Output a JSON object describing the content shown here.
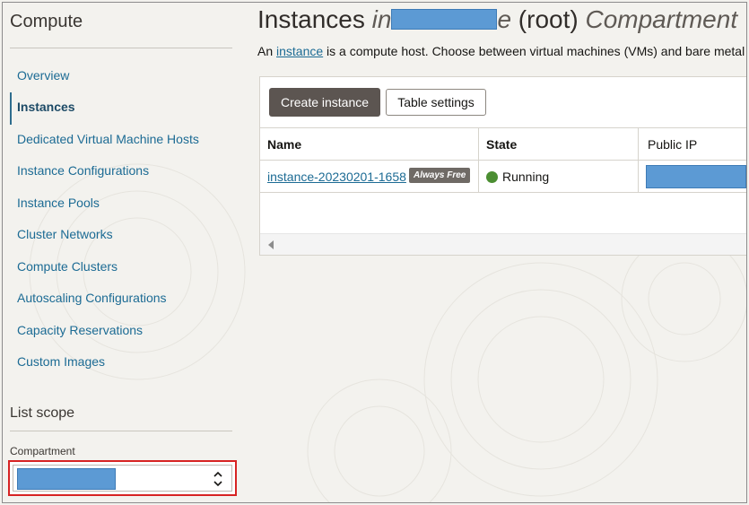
{
  "sidebar": {
    "title": "Compute",
    "items": [
      {
        "label": "Overview"
      },
      {
        "label": "Instances"
      },
      {
        "label": "Dedicated Virtual Machine Hosts"
      },
      {
        "label": "Instance Configurations"
      },
      {
        "label": "Instance Pools"
      },
      {
        "label": "Cluster Networks"
      },
      {
        "label": "Compute Clusters"
      },
      {
        "label": "Autoscaling Configurations"
      },
      {
        "label": "Capacity Reservations"
      },
      {
        "label": "Custom Images"
      }
    ],
    "list_scope": {
      "title": "List scope",
      "compartment_label": "Compartment"
    }
  },
  "main": {
    "title_prefix": "Instances",
    "title_partial_start": "in",
    "title_partial_end": "e",
    "title_root": "(root)",
    "title_suffix": "Compartment",
    "description_before": "An ",
    "description_link": "instance",
    "description_after": " is a compute host. Choose between virtual machines (VMs) and bare metal i",
    "buttons": {
      "create": "Create instance",
      "table_settings": "Table settings"
    },
    "table": {
      "columns": [
        "Name",
        "State",
        "Public IP"
      ],
      "rows": [
        {
          "name": "instance-20230201-1658",
          "badge": "Always Free",
          "state": "Running"
        }
      ]
    }
  },
  "colors": {
    "link": "#1c6b94",
    "primary_button": "#5c5551",
    "running": "#4b8e32",
    "highlight_border": "#d72323",
    "redaction": "#5c9ad4"
  }
}
